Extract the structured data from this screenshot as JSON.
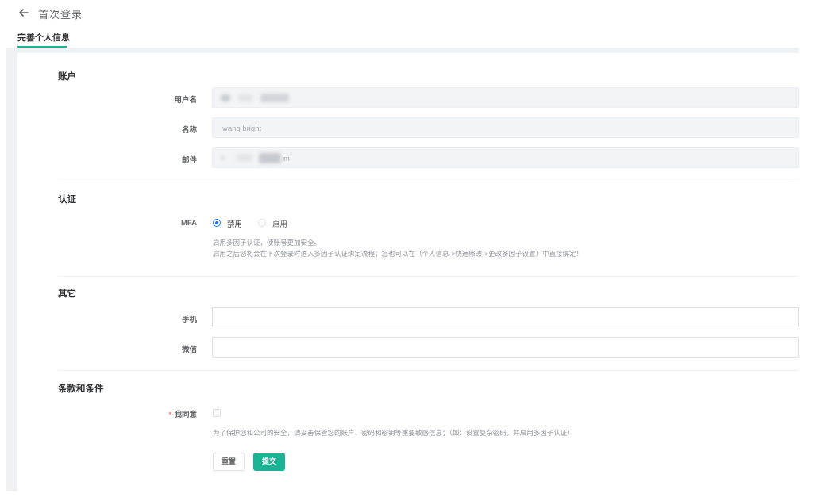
{
  "header": {
    "back_icon": "arrow-left-icon",
    "title": "首次登录"
  },
  "tabs": [
    {
      "label": "完善个人信息",
      "active": true
    }
  ],
  "sections": {
    "account": {
      "title": "账户",
      "username": {
        "label": "用户名",
        "value": ""
      },
      "name": {
        "label": "名称",
        "value": "wang bright"
      },
      "email": {
        "label": "邮件",
        "value": "m"
      }
    },
    "auth": {
      "title": "认证",
      "mfa": {
        "label": "MFA",
        "options": [
          {
            "label": "禁用",
            "selected": true
          },
          {
            "label": "启用",
            "selected": false
          }
        ],
        "help_line1": "启用多因子认证，使账号更加安全。",
        "help_line2": "启用之后您将会在下次登录时进入多因子认证绑定流程；您也可以在（个人信息->快速修改->更改多因子设置）中直接绑定！"
      }
    },
    "other": {
      "title": "其它",
      "phone": {
        "label": "手机",
        "value": ""
      },
      "wechat": {
        "label": "微信",
        "value": ""
      }
    },
    "terms": {
      "title": "条款和条件",
      "agree": {
        "required_mark": "*",
        "label": "我同意",
        "checked": false
      },
      "help": "为了保护您和公司的安全，请妥善保管您的账户、密码和密钥等重要敏感信息；（如：设置复杂密码，并启用多因子认证）"
    }
  },
  "actions": {
    "reset_label": "重置",
    "submit_label": "提交"
  },
  "colors": {
    "accent": "#1ab394",
    "radio_selected": "#1677ff",
    "required": "#f56c6c"
  }
}
